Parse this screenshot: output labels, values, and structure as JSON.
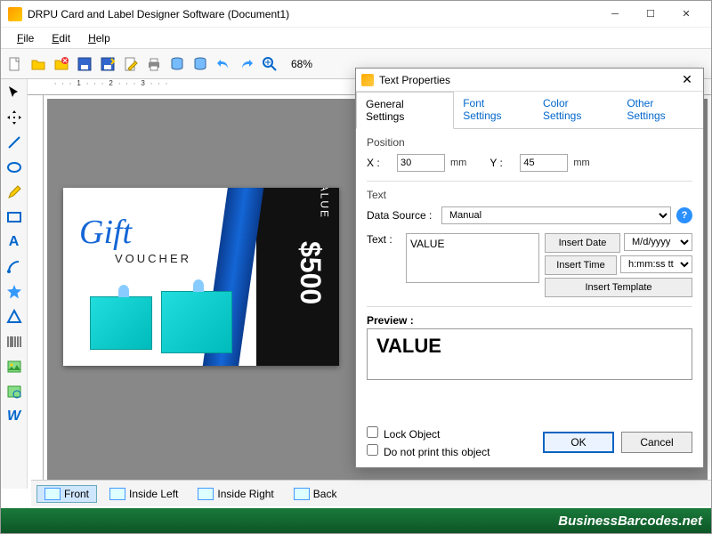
{
  "window": {
    "title": "DRPU Card and Label Designer Software (Document1)"
  },
  "menu": {
    "file": "File",
    "edit": "Edit",
    "help": "Help"
  },
  "toolbar": {
    "zoom": "68%"
  },
  "side_tabs": {
    "front": "Front",
    "inside_left": "Inside Left",
    "inside_right": "Inside Right",
    "back": "Back"
  },
  "card": {
    "gift": "Gift",
    "voucher": "VOUCHER",
    "value_label": "VALUE",
    "value_amount": "$500"
  },
  "dialog": {
    "title": "Text Properties",
    "tabs": {
      "general": "General Settings",
      "font": "Font Settings",
      "color": "Color Settings",
      "other": "Other Settings"
    },
    "position_label": "Position",
    "x_label": "X :",
    "x_value": "30",
    "x_unit": "mm",
    "y_label": "Y :",
    "y_value": "45",
    "y_unit": "mm",
    "text_group": "Text",
    "datasource_label": "Data Source :",
    "datasource_value": "Manual",
    "text_label": "Text :",
    "text_value": "VALUE",
    "insert_date": "Insert Date",
    "date_fmt": "M/d/yyyy",
    "insert_time": "Insert Time",
    "time_fmt": "h:mm:ss tt",
    "insert_template": "Insert Template",
    "preview_label": "Preview :",
    "preview_value": "VALUE",
    "lock": "Lock Object",
    "noprint": "Do not print this object",
    "ok": "OK",
    "cancel": "Cancel"
  },
  "footer": {
    "brand": "BusinessBarcodes.net"
  }
}
